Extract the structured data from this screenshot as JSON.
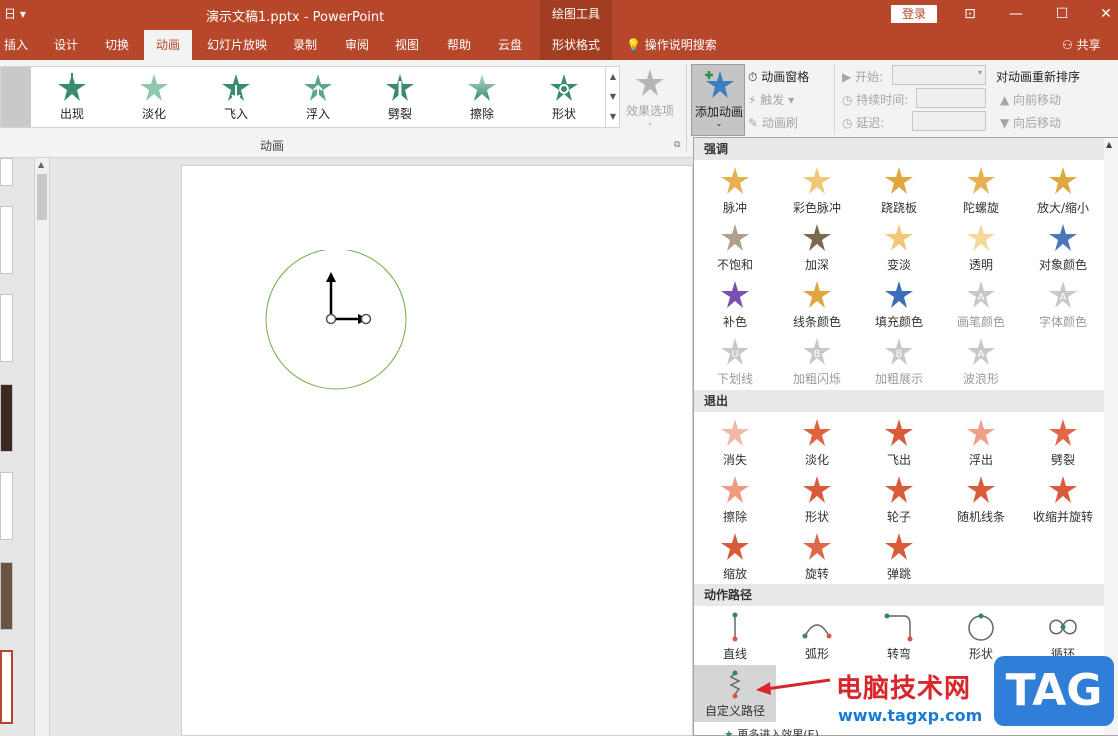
{
  "titlebar": {
    "quick_access": "日 ▾",
    "document": "演示文稿1.pptx  -  PowerPoint",
    "context_tab": "绘图工具",
    "login": "登录",
    "restore_glyph": "⊡",
    "minimize_glyph": "—",
    "maximize_glyph": "☐",
    "close_glyph": "✕"
  },
  "tabs": [
    "插入",
    "设计",
    "切换",
    "动画",
    "幻灯片放映",
    "录制",
    "审阅",
    "视图",
    "帮助",
    "云盘",
    "形状格式"
  ],
  "tell_me": "操作说明搜索",
  "share": "共享",
  "ribbon": {
    "gallery": [
      "出现",
      "淡化",
      "飞入",
      "浮入",
      "劈裂",
      "擦除",
      "形状"
    ],
    "effect_options": "效果选项",
    "group_label": "动画",
    "add_animation": "添加动画",
    "anim_pane": "动画窗格",
    "trigger": "触发",
    "anim_painter": "动画刷",
    "start": "开始:",
    "duration": "持续时间:",
    "delay": "延迟:",
    "reorder": "对动画重新排序",
    "move_earlier": "向前移动",
    "move_later": "向后移动"
  },
  "panel": {
    "emphasis_header": "强调",
    "emphasis": [
      {
        "label": "脉冲",
        "dim": false
      },
      {
        "label": "彩色脉冲",
        "dim": false
      },
      {
        "label": "跷跷板",
        "dim": false
      },
      {
        "label": "陀螺旋",
        "dim": false
      },
      {
        "label": "放大/缩小",
        "dim": false
      },
      {
        "label": "不饱和",
        "dim": false
      },
      {
        "label": "加深",
        "dim": false
      },
      {
        "label": "变淡",
        "dim": false
      },
      {
        "label": "透明",
        "dim": false
      },
      {
        "label": "对象颜色",
        "dim": false
      },
      {
        "label": "补色",
        "dim": false
      },
      {
        "label": "线条颜色",
        "dim": false
      },
      {
        "label": "填充颜色",
        "dim": false
      },
      {
        "label": "画笔颜色",
        "dim": true
      },
      {
        "label": "字体颜色",
        "dim": true
      },
      {
        "label": "下划线",
        "dim": true
      },
      {
        "label": "加粗闪烁",
        "dim": true
      },
      {
        "label": "加粗展示",
        "dim": true
      },
      {
        "label": "波浪形",
        "dim": true
      }
    ],
    "exit_header": "退出",
    "exit": [
      "消失",
      "淡化",
      "飞出",
      "浮出",
      "劈裂",
      "擦除",
      "形状",
      "轮子",
      "随机线条",
      "收缩并旋转",
      "缩放",
      "旋转",
      "弹跳"
    ],
    "path_header": "动作路径",
    "paths": [
      "直线",
      "弧形",
      "转弯",
      "形状",
      "循环",
      "自定义路径"
    ],
    "more": "更多进入效果(E)..."
  },
  "watermark": {
    "text": "电脑技术网",
    "url": "www.tagxp.com",
    "logo": "TAG"
  },
  "colors": {
    "brand": "#b7472a",
    "entrance": "#3a8a6e",
    "emphasis": "#e0a640",
    "exit": "#d95b3a",
    "path": "#2e8b57"
  }
}
